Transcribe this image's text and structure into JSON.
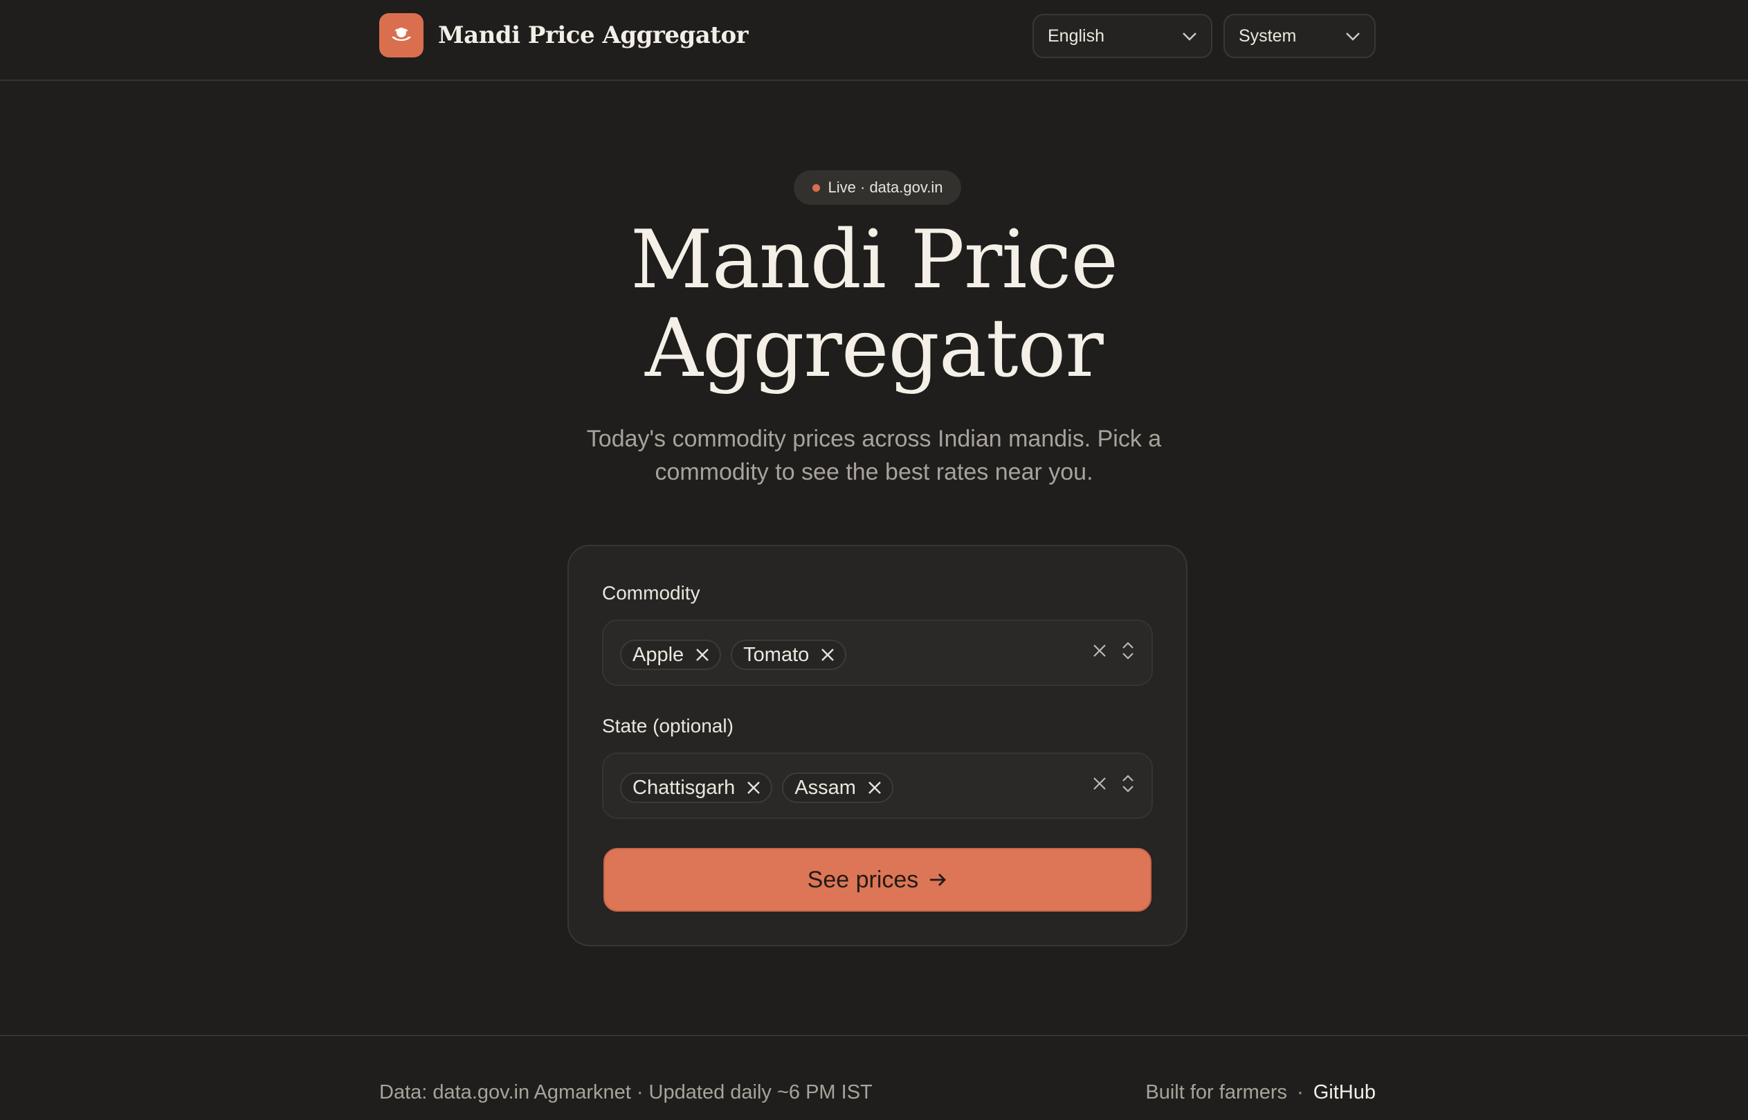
{
  "header": {
    "title": "Mandi Price Aggregator",
    "logo_icon": "farmer-icon",
    "language_select": {
      "value": "English"
    },
    "theme_select": {
      "value": "System"
    }
  },
  "hero": {
    "badge": "Live · data.gov.in",
    "title_line1": "Mandi Price",
    "title_line2": "Aggregator",
    "subtitle_line1": "Today's commodity prices across Indian mandis. Pick a",
    "subtitle_line2": "commodity to see the best rates near you."
  },
  "form": {
    "commodity_label": "Commodity",
    "commodities": [
      "Apple",
      "Tomato"
    ],
    "state_label": "State (optional)",
    "states": [
      "Chattisgarh",
      "Assam"
    ],
    "submit_label": "See prices"
  },
  "footer": {
    "left_text": "Data: data.gov.in Agmarknet · Updated daily ~6 PM IST",
    "built_text": "Built for farmers",
    "separator": "·",
    "github_link": "GitHub"
  },
  "colors": {
    "background": "#1f1e1c",
    "accent": "#dc7656",
    "card": "#262523"
  }
}
